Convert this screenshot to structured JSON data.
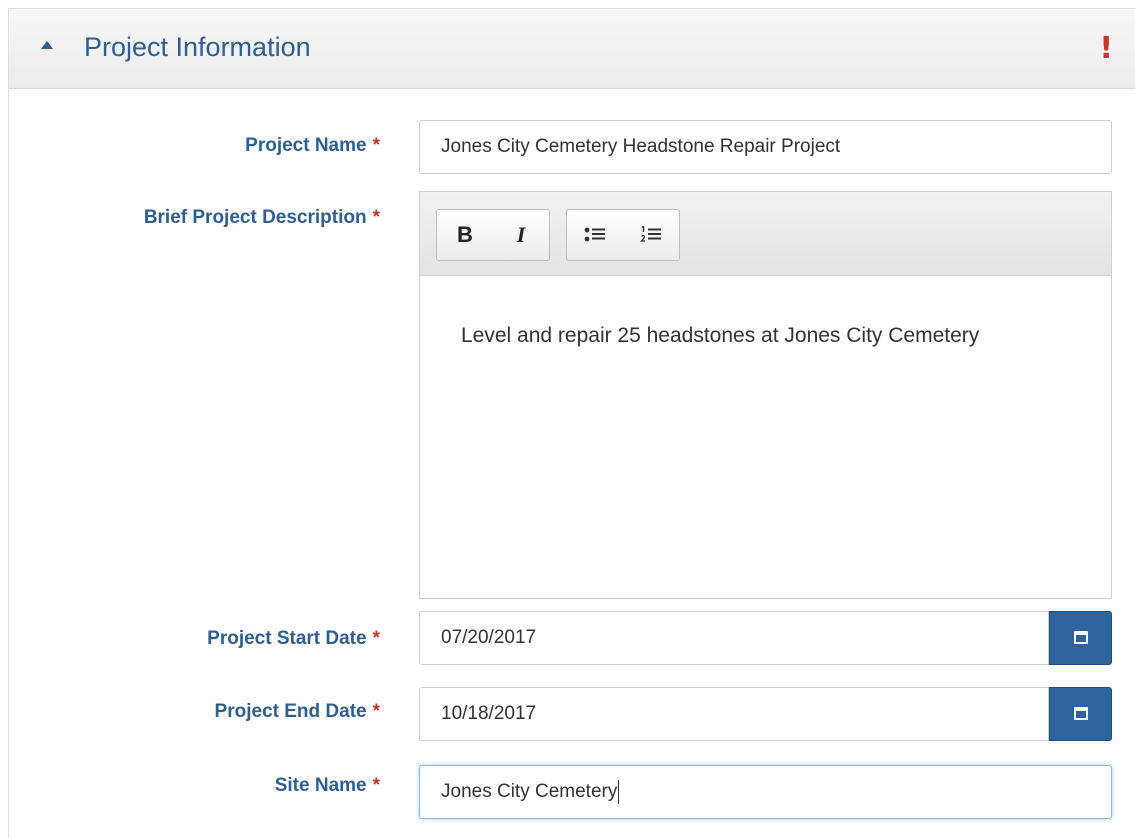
{
  "panel": {
    "title": "Project Information",
    "error_mark": "!"
  },
  "form": {
    "required_marker": "*",
    "project_name": {
      "label": "Project Name",
      "value": "Jones City Cemetery Headstone Repair Project"
    },
    "description": {
      "label": "Brief Project Description",
      "toolbar": {
        "bold": "B",
        "italic": "I"
      },
      "value": "Level and repair 25 headstones at Jones City Cemetery"
    },
    "start_date": {
      "label": "Project Start Date",
      "value": "07/20/2017"
    },
    "end_date": {
      "label": "Project End Date",
      "value": "10/18/2017"
    },
    "site_name": {
      "label": "Site Name",
      "value": "Jones City Cemetery"
    }
  },
  "icons": {
    "collapse": "caret-up-icon",
    "error": "exclamation-icon",
    "calendar": "calendar-icon",
    "bullet_list": "bullet-list-icon",
    "numbered_list": "numbered-list-icon"
  },
  "colors": {
    "accent": "#2d5f93",
    "button": "#2d64a0",
    "required": "#c0392b"
  }
}
